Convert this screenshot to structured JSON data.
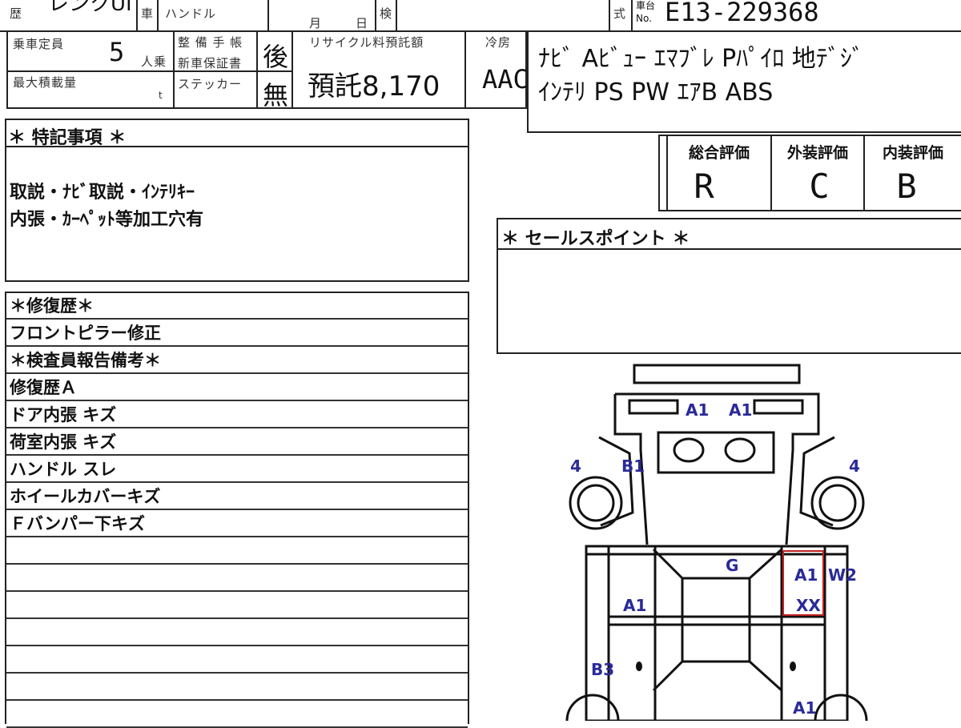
{
  "header": {
    "history_label": "歴",
    "model_partial": "レンクUI",
    "vehicle_label": "車",
    "handle_label": "ハンドル",
    "month_label": "月",
    "day_label": "日",
    "inspection_label": "検",
    "type_label": "式",
    "chassis_label": "車台",
    "chassis_no_label": "No.",
    "chassis_no": "E13-229368"
  },
  "specs": {
    "capacity_label": "乗車定員",
    "capacity_value": "5",
    "capacity_unit": "人乗",
    "max_load_label": "最大積載量",
    "max_load_unit": "t",
    "manual_label_1": "整 備 手 帳",
    "manual_label_2": "新車保証書",
    "manual_value": "後",
    "sticker_label": "ステッカー",
    "sticker_value": "無",
    "recycle_label": "リサイクル料預託額",
    "recycle_value": "預託8,170",
    "ac_label": "冷房",
    "ac_value": "AAC"
  },
  "equipment": {
    "line1": "ﾅﾋﾞ Aﾋﾞｭｰ ｴﾏﾌﾞﾚ Pﾊﾟｲﾛ 地ﾃﾞｼﾞ",
    "line2": "ｲﾝﾃﾘ PS PW ｴｱB ABS"
  },
  "grades": {
    "overall_label": "総合評価",
    "overall_value": "R",
    "exterior_label": "外装評価",
    "exterior_value": "C",
    "interior_label": "内装評価",
    "interior_value": "B"
  },
  "notes": {
    "title": "＊ 特記事項 ＊",
    "line1": "取説・ﾅﾋﾞ取説・ｲﾝﾃﾘｷｰ",
    "line2": "内張・ｶｰﾍﾟｯﾄ等加工穴有"
  },
  "sales": {
    "title": "＊ セールスポイント ＊"
  },
  "repair": {
    "title": "＊修復歴＊",
    "value": "フロントピラー修正",
    "report_title": "＊検査員報告備考＊",
    "items": [
      "修復歴Ａ",
      "ドア内張 キズ",
      "荷室内張 キズ",
      "ハンドル スレ",
      "ホイールカバーキズ",
      "Ｆバンパー下キズ",
      "",
      "",
      "",
      "",
      "",
      "",
      ""
    ]
  },
  "damage_marks": {
    "a1_left_top": "A1",
    "a1_right_top": "A1",
    "wheel_front_left": "4",
    "wheel_front_right": "4",
    "b1": "B1",
    "g": "G",
    "a1_door_right": "A1",
    "w2": "W2",
    "xx": "XX",
    "a1_door_left": "A1",
    "b3": "B3",
    "a1_bottom_right": "A1"
  },
  "colors": {
    "damage_mark": "#2a2a9a",
    "repair_outline": "#c02020"
  }
}
